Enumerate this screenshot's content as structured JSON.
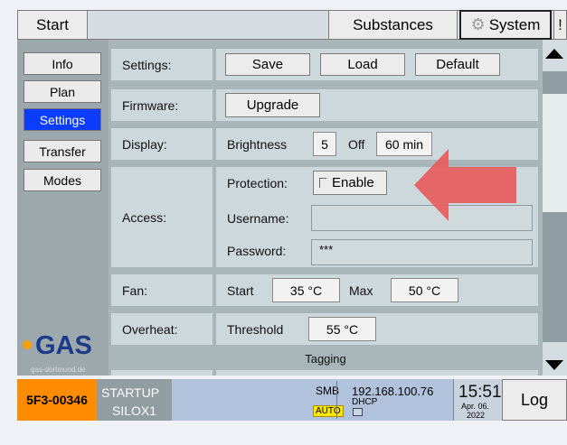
{
  "top": {
    "start": "Start",
    "substances": "Substances",
    "system": "System",
    "bang": "!"
  },
  "nav": [
    "Info",
    "Plan",
    "Settings",
    "Transfer",
    "Modes"
  ],
  "rows": {
    "settings": {
      "label": "Settings:",
      "save": "Save",
      "load": "Load",
      "default": "Default"
    },
    "firmware": {
      "label": "Firmware:",
      "upgrade": "Upgrade"
    },
    "display": {
      "label": "Display:",
      "brightness": "Brightness",
      "brightness_val": "5",
      "off": "Off",
      "off_val": "60 min"
    },
    "access": {
      "label": "Access:",
      "protection": "Protection:",
      "enable": "Enable",
      "username": "Username:",
      "username_val": "",
      "password": "Password:",
      "password_val": "***"
    },
    "fan": {
      "label": "Fan:",
      "start": "Start",
      "start_val": "35 °C",
      "max": "Max",
      "max_val": "50 °C"
    },
    "overheat": {
      "label": "Overheat:",
      "threshold": "Threshold",
      "threshold_val": "55 °C"
    },
    "tagging": "Tagging"
  },
  "logo": {
    "text": "GAS",
    "url": "gas-dortmund.de"
  },
  "status": {
    "serial": "5F3-00346",
    "state": "STARTUP",
    "device": "SILOX1",
    "smb": "SMB",
    "auto": "AUTO",
    "ip": "192.168.100.76",
    "dhcp": "DHCP",
    "time": "15:51",
    "date": "Apr. 06.",
    "year": "2022",
    "log": "Log"
  },
  "colors": {
    "active_nav": "#0b3cff",
    "serial_bg": "#ff8c00",
    "arrow": "#e85a5a"
  }
}
